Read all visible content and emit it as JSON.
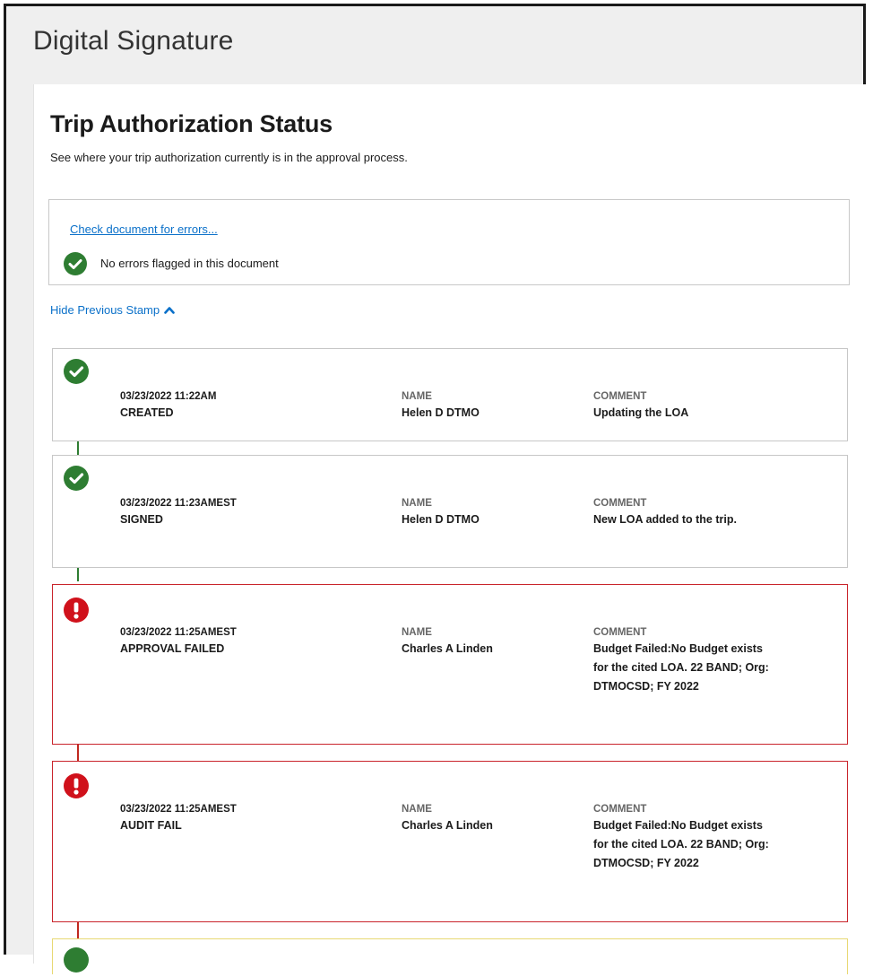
{
  "app_title": "Digital Signature",
  "page": {
    "title": "Trip Authorization Status",
    "subtitle": "See where your trip authorization currently is in the approval process."
  },
  "error_check": {
    "link_label": "Check document for errors...",
    "status_text": "No errors flagged in this document"
  },
  "toggle_label": "Hide Previous Stamp",
  "column_labels": {
    "name": "NAME",
    "comment": "COMMENT"
  },
  "stamps": [
    {
      "timestamp": "03/23/2022 11:22AM",
      "status": "CREATED",
      "name": "Helen D DTMO",
      "comment": "Updating the LOA",
      "state": "success"
    },
    {
      "timestamp": "03/23/2022 11:23AMEST",
      "status": "SIGNED",
      "name": "Helen D DTMO",
      "comment": "New LOA added to the trip.",
      "state": "success"
    },
    {
      "timestamp": "03/23/2022 11:25AMEST",
      "status": "APPROVAL FAILED",
      "name": "Charles A Linden",
      "comment": "Budget Failed:No Budget exists for the cited LOA. 22 BAND; Org: DTMOCSD; FY 2022",
      "state": "failed"
    },
    {
      "timestamp": "03/23/2022 11:25AMEST",
      "status": "AUDIT FAIL",
      "name": "Charles A Linden",
      "comment": "Budget Failed:No Budget exists for the cited LOA. 22 BAND; Org: DTMOCSD; FY 2022",
      "state": "failed"
    }
  ],
  "colors": {
    "success": "#2e7d32",
    "failure": "#d0111b",
    "link": "#0a70c9",
    "pending_border": "#e8d873"
  }
}
